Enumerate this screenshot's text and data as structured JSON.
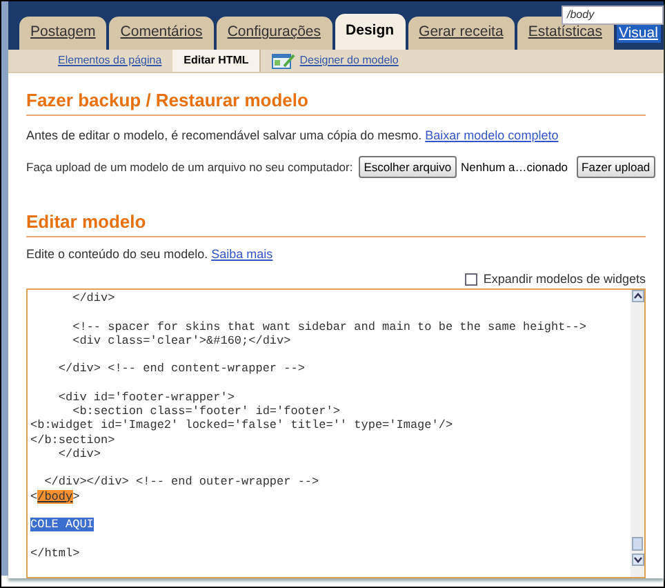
{
  "find_field": {
    "value": "/body"
  },
  "tabs": [
    {
      "label": "Postagem",
      "selected": false
    },
    {
      "label": "Comentários",
      "selected": false
    },
    {
      "label": "Configurações",
      "selected": false
    },
    {
      "label": "Design",
      "selected": true
    },
    {
      "label": "Gerar receita",
      "selected": false
    },
    {
      "label": "Estatísticas",
      "selected": false
    },
    {
      "label": "Visual",
      "selected": false,
      "kind": "link"
    }
  ],
  "subtabs": [
    {
      "label": "Elementos da página",
      "selected": false
    },
    {
      "label": "Editar HTML",
      "selected": true
    },
    {
      "label": "Designer do modelo",
      "selected": false,
      "icon": true
    }
  ],
  "backup": {
    "title": "Fazer backup / Restaurar modelo",
    "text": "Antes de editar o modelo, é recomendável salvar uma cópia do mesmo.",
    "link": "Baixar modelo completo",
    "upload_label": "Faça upload de um modelo de um arquivo no seu computador:",
    "choose_button": "Escolher arquivo",
    "file_name": "Nenhum a…cionado",
    "upload_button": "Fazer upload"
  },
  "edit": {
    "title": "Editar modelo",
    "text": "Edite o conteúdo do seu modelo.",
    "link": "Saiba mais",
    "expand_checkbox": {
      "label": "Expandir modelos de widgets",
      "checked": false
    }
  },
  "code_blocks": [
    [
      [
        {
          "text": "      </div>",
          "kind": "plain"
        }
      ]
    ],
    [
      [
        {
          "text": "      <!-- spacer for skins that want sidebar and main to be the same height-->",
          "kind": "plain"
        }
      ],
      [
        {
          "text": "      <div class='clear'>&#160;</div>",
          "kind": "plain"
        }
      ]
    ],
    [
      [
        {
          "text": "    </div> <!-- end content-wrapper -->",
          "kind": "plain"
        }
      ]
    ],
    [
      [
        {
          "text": "    <div id='footer-wrapper'>",
          "kind": "plain"
        }
      ],
      [
        {
          "text": "      <b:section class='footer' id='footer'>",
          "kind": "plain"
        }
      ],
      [
        {
          "text": "<b:widget id='Image2' locked='false' title='' type='Image'/>",
          "kind": "plain"
        }
      ],
      [
        {
          "text": "</b:section>",
          "kind": "plain"
        }
      ],
      [
        {
          "text": "    </div>",
          "kind": "plain"
        }
      ]
    ],
    [
      [
        {
          "text": "  </div></div> <!-- end outer-wrapper -->",
          "kind": "plain"
        }
      ],
      [
        {
          "text": "<",
          "kind": "plain"
        },
        {
          "text": "/body",
          "kind": "match"
        },
        {
          "text": ">",
          "kind": "plain"
        }
      ]
    ],
    [
      [
        {
          "text": "COLE AQUI",
          "kind": "selection"
        }
      ]
    ],
    [
      [
        {
          "text": "</html>",
          "kind": "plain"
        }
      ]
    ]
  ]
}
